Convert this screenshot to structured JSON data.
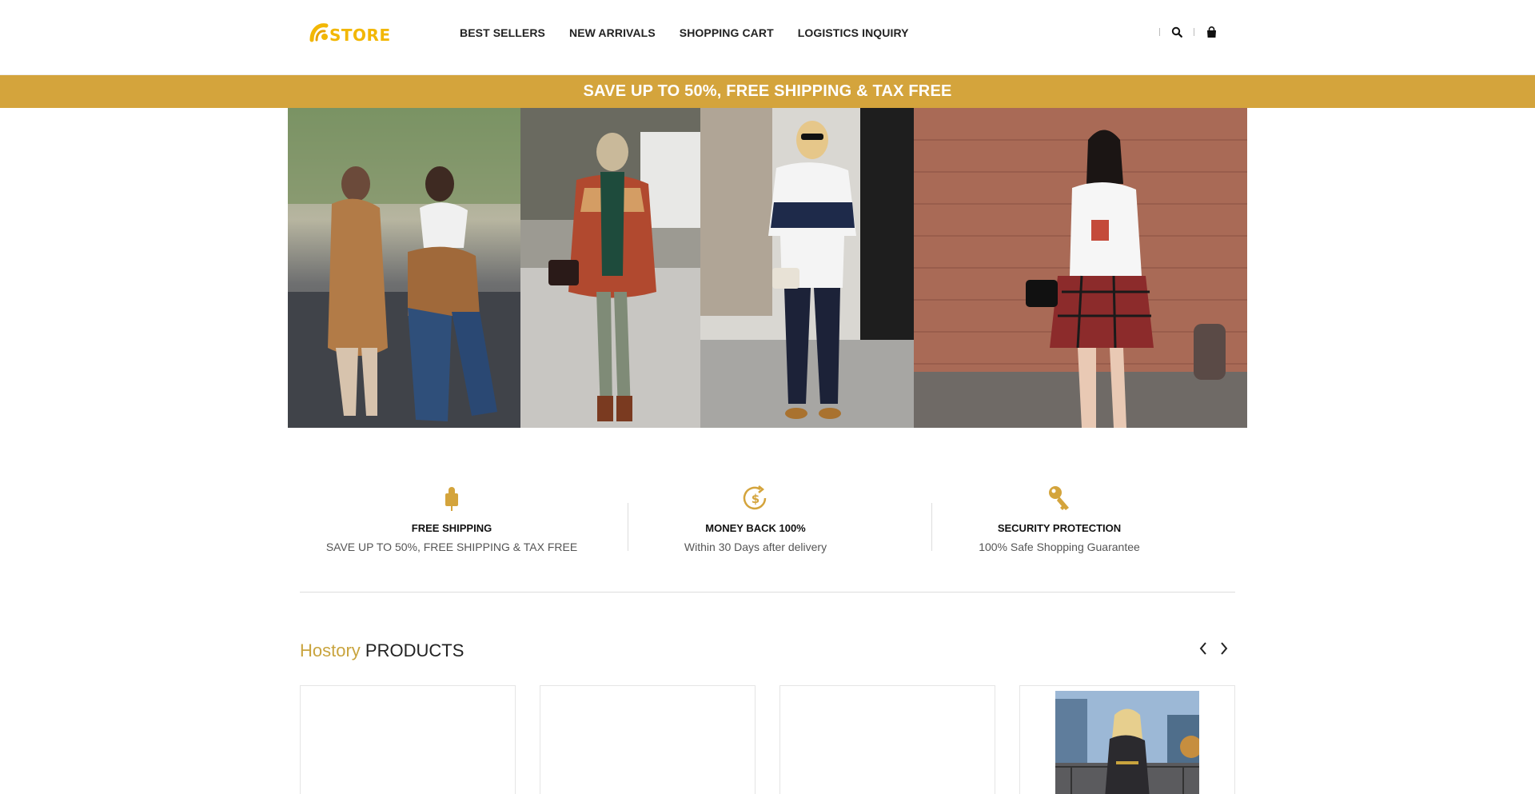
{
  "header": {
    "logo_text": "STORE",
    "nav": [
      {
        "label": "BEST SELLERS"
      },
      {
        "label": "NEW ARRIVALS"
      },
      {
        "label": "SHOPPING CART"
      },
      {
        "label": "LOGISTICS INQUIRY"
      }
    ],
    "icons": [
      "search-icon",
      "shopping-bag-icon"
    ]
  },
  "promo": {
    "text": "SAVE UP TO 50%, FREE SHIPPING & TAX FREE"
  },
  "hero": {
    "panels": [
      "street-style-photo-1",
      "street-style-photo-2",
      "street-style-photo-3",
      "street-style-photo-4"
    ]
  },
  "features": [
    {
      "icon": "lock-icon",
      "title": "FREE SHIPPING",
      "desc": "SAVE UP TO 50%, FREE SHIPPING & TAX FREE"
    },
    {
      "icon": "money-back-icon",
      "title": "MONEY BACK 100%",
      "desc": "Within 30 Days after delivery"
    },
    {
      "icon": "key-icon",
      "title": "SECURITY PROTECTION",
      "desc": "100% Safe Shopping Guarantee"
    }
  ],
  "products": {
    "title_accent": "Hostory",
    "title_main": "PRODUCTS"
  },
  "colors": {
    "accent": "#d4a43c",
    "logo": "#f2b705",
    "title_accent": "#c9a43e"
  }
}
